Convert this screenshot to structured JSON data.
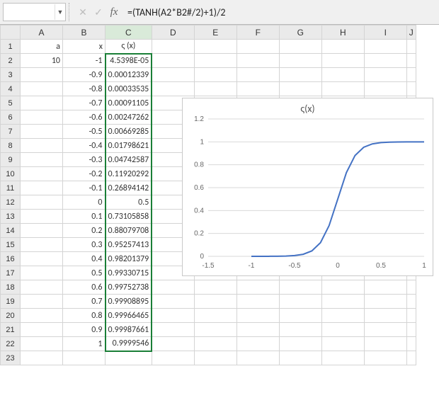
{
  "formula_bar": {
    "name_box": "",
    "cancel_icon": "✕",
    "enter_icon": "✓",
    "fx_label": "fx",
    "formula": "=(TANH(A2*B2#/2)+1)/2"
  },
  "columns": [
    "A",
    "B",
    "C",
    "D",
    "E",
    "F",
    "G",
    "H",
    "I",
    "J"
  ],
  "headers": {
    "A": "a",
    "B": "x",
    "C": "ς (x)"
  },
  "col_a": {
    "value": "10"
  },
  "rows": [
    {
      "x": "-1",
      "y": "4.5398E-05"
    },
    {
      "x": "-0.9",
      "y": "0.00012339"
    },
    {
      "x": "-0.8",
      "y": "0.00033535"
    },
    {
      "x": "-0.7",
      "y": "0.00091105"
    },
    {
      "x": "-0.6",
      "y": "0.00247262"
    },
    {
      "x": "-0.5",
      "y": "0.00669285"
    },
    {
      "x": "-0.4",
      "y": "0.01798621"
    },
    {
      "x": "-0.3",
      "y": "0.04742587"
    },
    {
      "x": "-0.2",
      "y": "0.11920292"
    },
    {
      "x": "-0.1",
      "y": "0.26894142"
    },
    {
      "x": "0",
      "y": "0.5"
    },
    {
      "x": "0.1",
      "y": "0.73105858"
    },
    {
      "x": "0.2",
      "y": "0.88079708"
    },
    {
      "x": "0.3",
      "y": "0.95257413"
    },
    {
      "x": "0.4",
      "y": "0.98201379"
    },
    {
      "x": "0.5",
      "y": "0.99330715"
    },
    {
      "x": "0.6",
      "y": "0.99752738"
    },
    {
      "x": "0.7",
      "y": "0.99908895"
    },
    {
      "x": "0.8",
      "y": "0.99966465"
    },
    {
      "x": "0.9",
      "y": "0.99987661"
    },
    {
      "x": "1",
      "y": "0.9999546"
    }
  ],
  "total_data_rows": 23,
  "chart_data": {
    "type": "line",
    "title": "ς(x)",
    "xlabel": "",
    "ylabel": "",
    "xlim": [
      -1.5,
      1
    ],
    "ylim": [
      0,
      1.2
    ],
    "xticks": [
      -1.5,
      -1,
      -0.5,
      0,
      0.5,
      1
    ],
    "yticks": [
      0,
      0.2,
      0.4,
      0.6,
      0.8,
      1,
      1.2
    ],
    "series": [
      {
        "name": "ς(x)",
        "x": [
          -1,
          -0.9,
          -0.8,
          -0.7,
          -0.6,
          -0.5,
          -0.4,
          -0.3,
          -0.2,
          -0.1,
          0,
          0.1,
          0.2,
          0.3,
          0.4,
          0.5,
          0.6,
          0.7,
          0.8,
          0.9,
          1
        ],
        "y": [
          4.54e-05,
          0.000123,
          0.000335,
          0.000911,
          0.00247,
          0.00669,
          0.01799,
          0.04743,
          0.1192,
          0.26894,
          0.5,
          0.73106,
          0.8808,
          0.95257,
          0.98201,
          0.99331,
          0.99753,
          0.99909,
          0.99966,
          0.99988,
          0.99995
        ]
      }
    ]
  }
}
